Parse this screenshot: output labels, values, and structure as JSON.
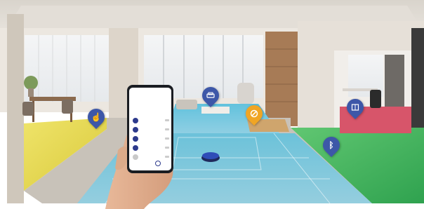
{
  "scene": {
    "colors": {
      "bedroom_yellow": "#e6d84a",
      "living_blue": "#59b9d8",
      "office_red": "#d7556a",
      "garden_green": "#36b15a",
      "pin_blue": "#3d57a8",
      "pin_orange": "#f0a524"
    },
    "pins": [
      {
        "name": "left-room-pin",
        "icon": "hand-pointer-icon",
        "color": "#3d57a8"
      },
      {
        "name": "sofa-pin",
        "icon": "sofa-icon",
        "color": "#3d57a8"
      },
      {
        "name": "no-go-pin",
        "icon": "no-entry-icon",
        "color": "#f0a524"
      },
      {
        "name": "office-pin",
        "icon": "book-icon",
        "color": "#3d57a8"
      },
      {
        "name": "bluetooth-pin",
        "icon": "bluetooth-icon",
        "color": "#3d57a8"
      }
    ]
  },
  "phone_app": {
    "rooms": [
      "",
      "",
      "",
      "",
      ""
    ]
  }
}
